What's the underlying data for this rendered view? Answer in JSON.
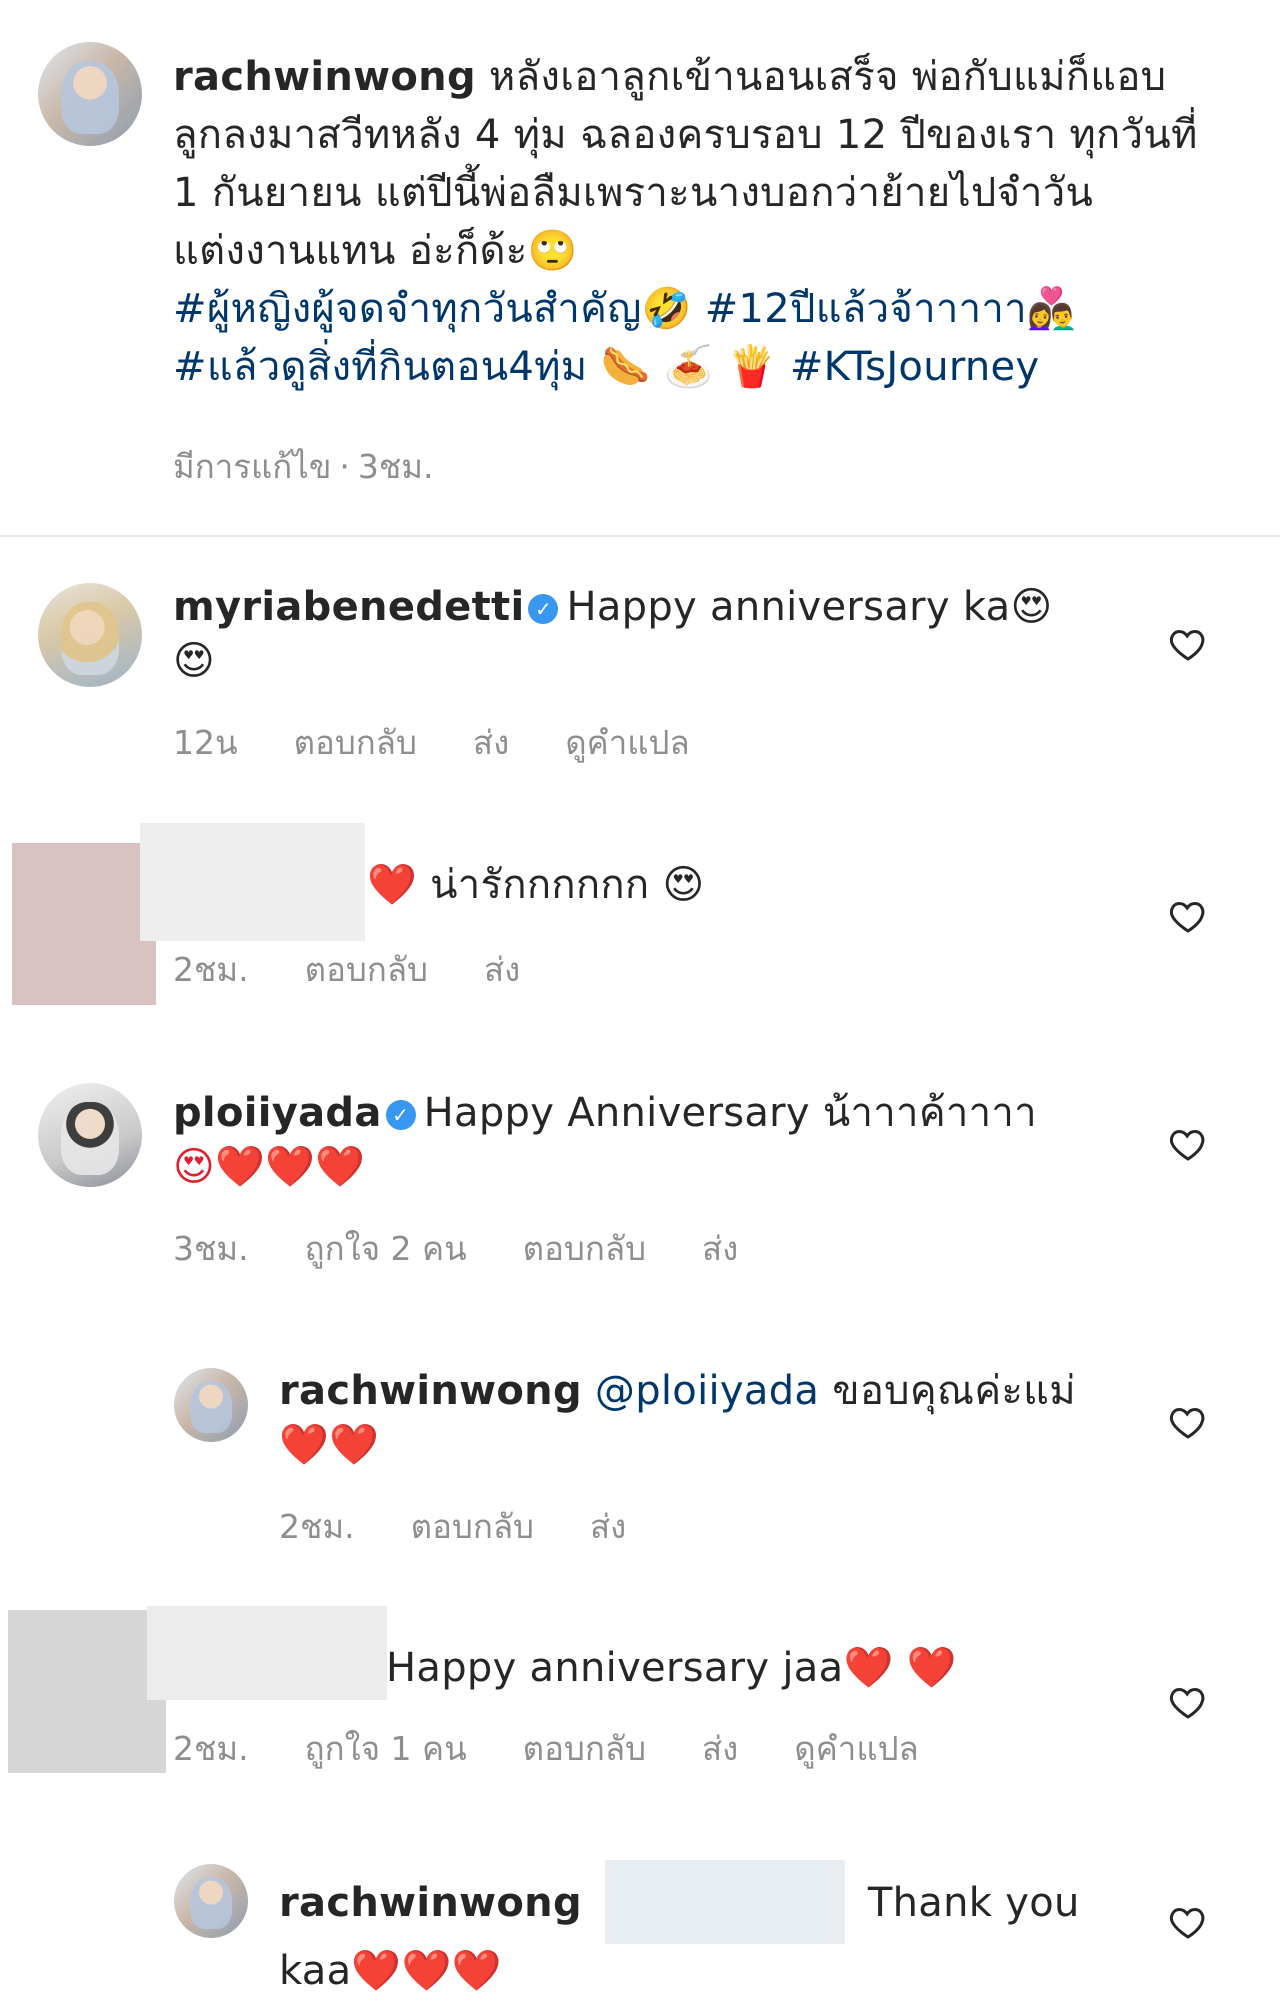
{
  "post": {
    "username": "rachwinwong",
    "caption": "หลังเอาลูกเข้านอนเสร็จ พ่อกับแม่ก็แอบลูกลงมาสวีทหลัง 4 ทุ่ม ฉลองครบรอบ 12 ปีของเรา ทุกวันที่ 1 กันยายน แต่ปีนี้พ่อลืมเพราะนางบอกว่าย้ายไปจำวันแต่งงานแทน อ่ะก็ด้ะ",
    "caption_emoji": "🙄",
    "hashtag_1": "#ผู้หญิงผู้จดจำทุกวันสำคัญ",
    "emoji_1": "🤣",
    "hashtag_2": "#12ปีแล้วจ้าาาาา",
    "emoji_2": "👩‍❤️‍👨",
    "hashtag_3": "#แล้วดูสิ่งที่กินตอน4ทุ่ม",
    "emoji_3": "🌭 🍝 🍟",
    "hashtag_4": "#KTsJourney",
    "edited_label": "มีการแก้ไข",
    "separator": "·",
    "time": "3ชม."
  },
  "comments": [
    {
      "username": "myriabenedetti",
      "verified": true,
      "text": "Happy anniversary ka",
      "emoji": "😍",
      "emoji_line2": "😍",
      "time": "12น",
      "reply": "ตอบกลับ",
      "send": "ส่ง",
      "translate": "ดูคำแปล"
    },
    {
      "username": "",
      "heart": "❤️",
      "text": "น่ารักกกกกก",
      "emoji": "😍",
      "time": "2ชม.",
      "reply": "ตอบกลับ",
      "send": "ส่ง"
    },
    {
      "username": "ploiiyada",
      "verified": true,
      "text": "Happy Anniversary น้าาาค้าาาา",
      "emoji_line2": "😍❤️❤️❤️",
      "time": "3ชม.",
      "likes": "ถูกใจ 2 คน",
      "reply": "ตอบกลับ",
      "send": "ส่ง"
    },
    {
      "username": "rachwinwong",
      "mention": "@ploiiyada",
      "text": "ขอบคุณค่ะแม่",
      "emoji_line2": "❤️❤️",
      "time": "2ชม.",
      "reply": "ตอบกลับ",
      "send": "ส่ง"
    },
    {
      "username": "",
      "text": "Happy anniversary jaa",
      "emoji": "❤️ ❤️",
      "time": "2ชม.",
      "likes": "ถูกใจ 1 คน",
      "reply": "ตอบกลับ",
      "send": "ส่ง",
      "translate": "ดูคำแปล"
    },
    {
      "username": "rachwinwong",
      "text": "Thank you",
      "text_line2": "kaa",
      "emoji_line2": "❤️❤️❤️"
    }
  ],
  "colors": {
    "text": "#262626",
    "meta": "#8e8e8e",
    "hashtag": "#00376b",
    "verified": "#3897f0",
    "divider": "#e6e6e6"
  },
  "icons": [
    "heart-outline-icon",
    "verified-badge-icon"
  ]
}
